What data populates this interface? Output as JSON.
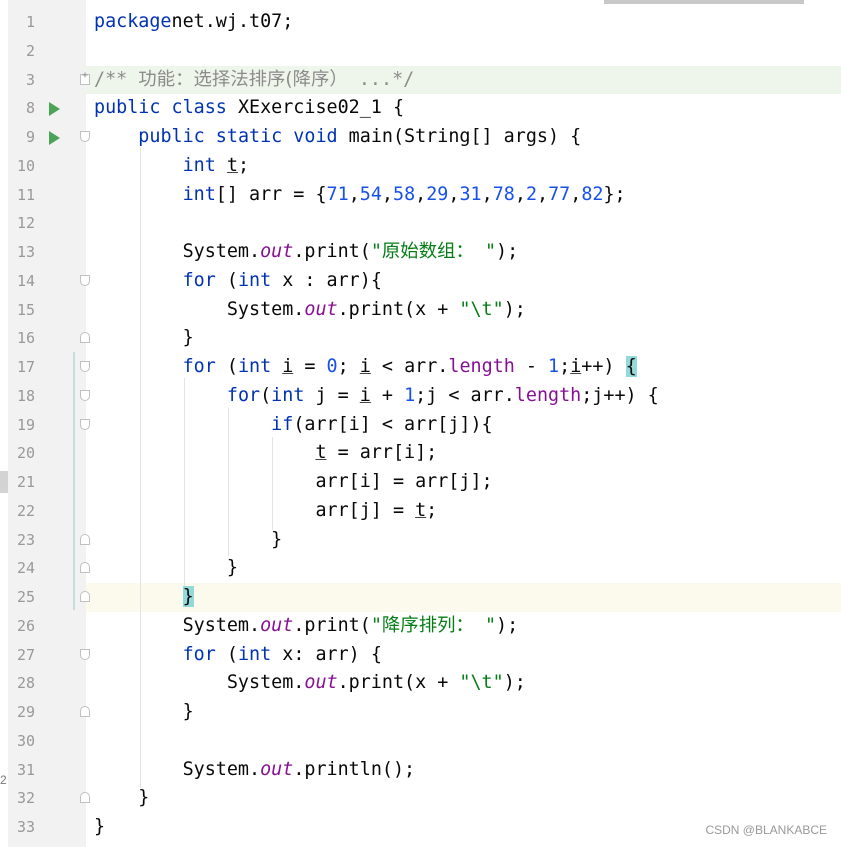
{
  "editor": {
    "lines": [
      {
        "n": "1",
        "segs": [
          [
            "kw",
            "package"
          ],
          [
            "",
            "net.wj.t07;"
          ]
        ]
      },
      {
        "n": "2",
        "segs": []
      },
      {
        "n": "3",
        "comment": true,
        "segs": [
          [
            "cmt",
            "/** "
          ],
          [
            "cmt cjk",
            "功能：选择法排序(降序）"
          ],
          [
            "cmt",
            " ...*/"
          ]
        ]
      },
      {
        "n": "8",
        "run": true,
        "segs": [
          [
            "kw",
            "public class "
          ],
          [
            "",
            "XExercise02_1 {"
          ]
        ]
      },
      {
        "n": "9",
        "run": true,
        "segs": [
          [
            "",
            "    "
          ],
          [
            "kw",
            "public static void "
          ],
          [
            "",
            "main(String[] args) {"
          ]
        ]
      },
      {
        "n": "10",
        "segs": [
          [
            "",
            "        "
          ],
          [
            "kw",
            "int "
          ],
          [
            "ul",
            "t"
          ],
          [
            "",
            ";"
          ]
        ]
      },
      {
        "n": "11",
        "segs": [
          [
            "",
            "        "
          ],
          [
            "kw",
            "int"
          ],
          [
            "",
            "[] arr = {"
          ],
          [
            "num",
            "71"
          ],
          [
            "",
            ","
          ],
          [
            "num",
            "54"
          ],
          [
            "",
            ","
          ],
          [
            "num",
            "58"
          ],
          [
            "",
            ","
          ],
          [
            "num",
            "29"
          ],
          [
            "",
            ","
          ],
          [
            "num",
            "31"
          ],
          [
            "",
            ","
          ],
          [
            "num",
            "78"
          ],
          [
            "",
            ","
          ],
          [
            "num",
            "2"
          ],
          [
            "",
            ","
          ],
          [
            "num",
            "77"
          ],
          [
            "",
            ","
          ],
          [
            "num",
            "82"
          ],
          [
            "",
            "};"
          ]
        ]
      },
      {
        "n": "12",
        "segs": []
      },
      {
        "n": "13",
        "segs": [
          [
            "",
            "        System."
          ],
          [
            "static",
            "out"
          ],
          [
            "",
            ".print("
          ],
          [
            "str",
            "\""
          ],
          [
            "str cjk",
            "原始数组："
          ],
          [
            "str",
            " \""
          ],
          [
            "",
            ");"
          ]
        ]
      },
      {
        "n": "14",
        "segs": [
          [
            "",
            "        "
          ],
          [
            "kw",
            "for "
          ],
          [
            "",
            "("
          ],
          [
            "kw",
            "int "
          ],
          [
            "",
            "x : arr){"
          ]
        ]
      },
      {
        "n": "15",
        "segs": [
          [
            "",
            "            System."
          ],
          [
            "static",
            "out"
          ],
          [
            "",
            ".print(x + "
          ],
          [
            "str",
            "\"\\t\""
          ],
          [
            "",
            ");"
          ]
        ]
      },
      {
        "n": "16",
        "segs": [
          [
            "",
            "        }"
          ]
        ]
      },
      {
        "n": "17",
        "segs": [
          [
            "",
            "        "
          ],
          [
            "kw",
            "for "
          ],
          [
            "",
            "("
          ],
          [
            "kw",
            "int "
          ],
          [
            "ul",
            "i"
          ],
          [
            "",
            " = "
          ],
          [
            "num",
            "0"
          ],
          [
            "",
            "; "
          ],
          [
            "ul",
            "i"
          ],
          [
            "",
            " < arr."
          ],
          [
            "field",
            "length"
          ],
          [
            "",
            " - "
          ],
          [
            "num",
            "1"
          ],
          [
            "",
            ";"
          ],
          [
            "ul",
            "i"
          ],
          [
            "",
            "++) "
          ],
          [
            "bracket-hl",
            "{"
          ]
        ]
      },
      {
        "n": "18",
        "segs": [
          [
            "",
            "            "
          ],
          [
            "kw",
            "for"
          ],
          [
            "",
            "("
          ],
          [
            "kw",
            "int "
          ],
          [
            "",
            "j = "
          ],
          [
            "ul",
            "i"
          ],
          [
            "",
            " + "
          ],
          [
            "num",
            "1"
          ],
          [
            "",
            ";j < arr."
          ],
          [
            "field",
            "length"
          ],
          [
            "",
            ";j++) {"
          ]
        ]
      },
      {
        "n": "19",
        "segs": [
          [
            "",
            "                "
          ],
          [
            "kw",
            "if"
          ],
          [
            "",
            "(arr[i] < arr[j]){"
          ]
        ]
      },
      {
        "n": "20",
        "segs": [
          [
            "",
            "                    "
          ],
          [
            "ul",
            "t"
          ],
          [
            "",
            " = arr[i];"
          ]
        ]
      },
      {
        "n": "21",
        "segs": [
          [
            "",
            "                    arr[i] = arr[j];"
          ]
        ]
      },
      {
        "n": "22",
        "segs": [
          [
            "",
            "                    arr[j] = "
          ],
          [
            "ul",
            "t"
          ],
          [
            "",
            ";"
          ]
        ]
      },
      {
        "n": "23",
        "segs": [
          [
            "",
            "                }"
          ]
        ]
      },
      {
        "n": "24",
        "segs": [
          [
            "",
            "            }"
          ]
        ]
      },
      {
        "n": "25",
        "current": true,
        "segs": [
          [
            "",
            "        "
          ],
          [
            "bracket-hl",
            "}"
          ]
        ]
      },
      {
        "n": "26",
        "segs": [
          [
            "",
            "        System."
          ],
          [
            "static",
            "out"
          ],
          [
            "",
            ".print("
          ],
          [
            "str",
            "\""
          ],
          [
            "str cjk",
            "降序排列："
          ],
          [
            "str",
            " \""
          ],
          [
            "",
            ");"
          ]
        ]
      },
      {
        "n": "27",
        "segs": [
          [
            "",
            "        "
          ],
          [
            "kw",
            "for "
          ],
          [
            "",
            "("
          ],
          [
            "kw",
            "int "
          ],
          [
            "",
            "x: arr) {"
          ]
        ]
      },
      {
        "n": "28",
        "segs": [
          [
            "",
            "            System."
          ],
          [
            "static",
            "out"
          ],
          [
            "",
            ".print(x + "
          ],
          [
            "str",
            "\"\\t\""
          ],
          [
            "",
            ");"
          ]
        ]
      },
      {
        "n": "29",
        "segs": [
          [
            "",
            "        }"
          ]
        ]
      },
      {
        "n": "30",
        "segs": []
      },
      {
        "n": "31",
        "segs": [
          [
            "",
            "        System."
          ],
          [
            "static",
            "out"
          ],
          [
            "",
            ".println();"
          ]
        ]
      },
      {
        "n": "32",
        "segs": [
          [
            "",
            "    }"
          ]
        ]
      },
      {
        "n": "33",
        "segs": [
          [
            "",
            "}"
          ]
        ]
      }
    ]
  },
  "side_marker": "2",
  "watermark": "CSDN @BLANKABCE",
  "colors": {
    "keyword": "#0033b3",
    "number": "#1750eb",
    "string": "#067d17",
    "field": "#871094",
    "run_icon": "#4aa457",
    "bracket_highlight": "#93d9d9"
  }
}
